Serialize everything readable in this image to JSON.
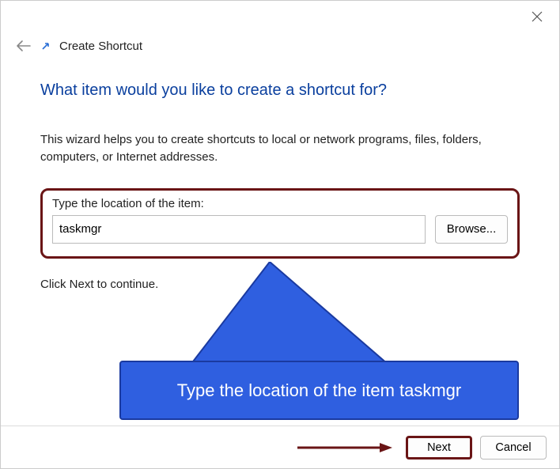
{
  "window": {
    "title": "Create Shortcut"
  },
  "heading": "What item would you like to create a shortcut for?",
  "description": "This wizard helps you to create shortcuts to local or network programs, files, folders, computers, or Internet addresses.",
  "input": {
    "label": "Type the location of the item:",
    "value": "taskmgr",
    "browse_label": "Browse..."
  },
  "continue_text": "Click Next to continue.",
  "callout": {
    "text": "Type the location of the item taskmgr"
  },
  "footer": {
    "next_label": "Next",
    "cancel_label": "Cancel"
  }
}
